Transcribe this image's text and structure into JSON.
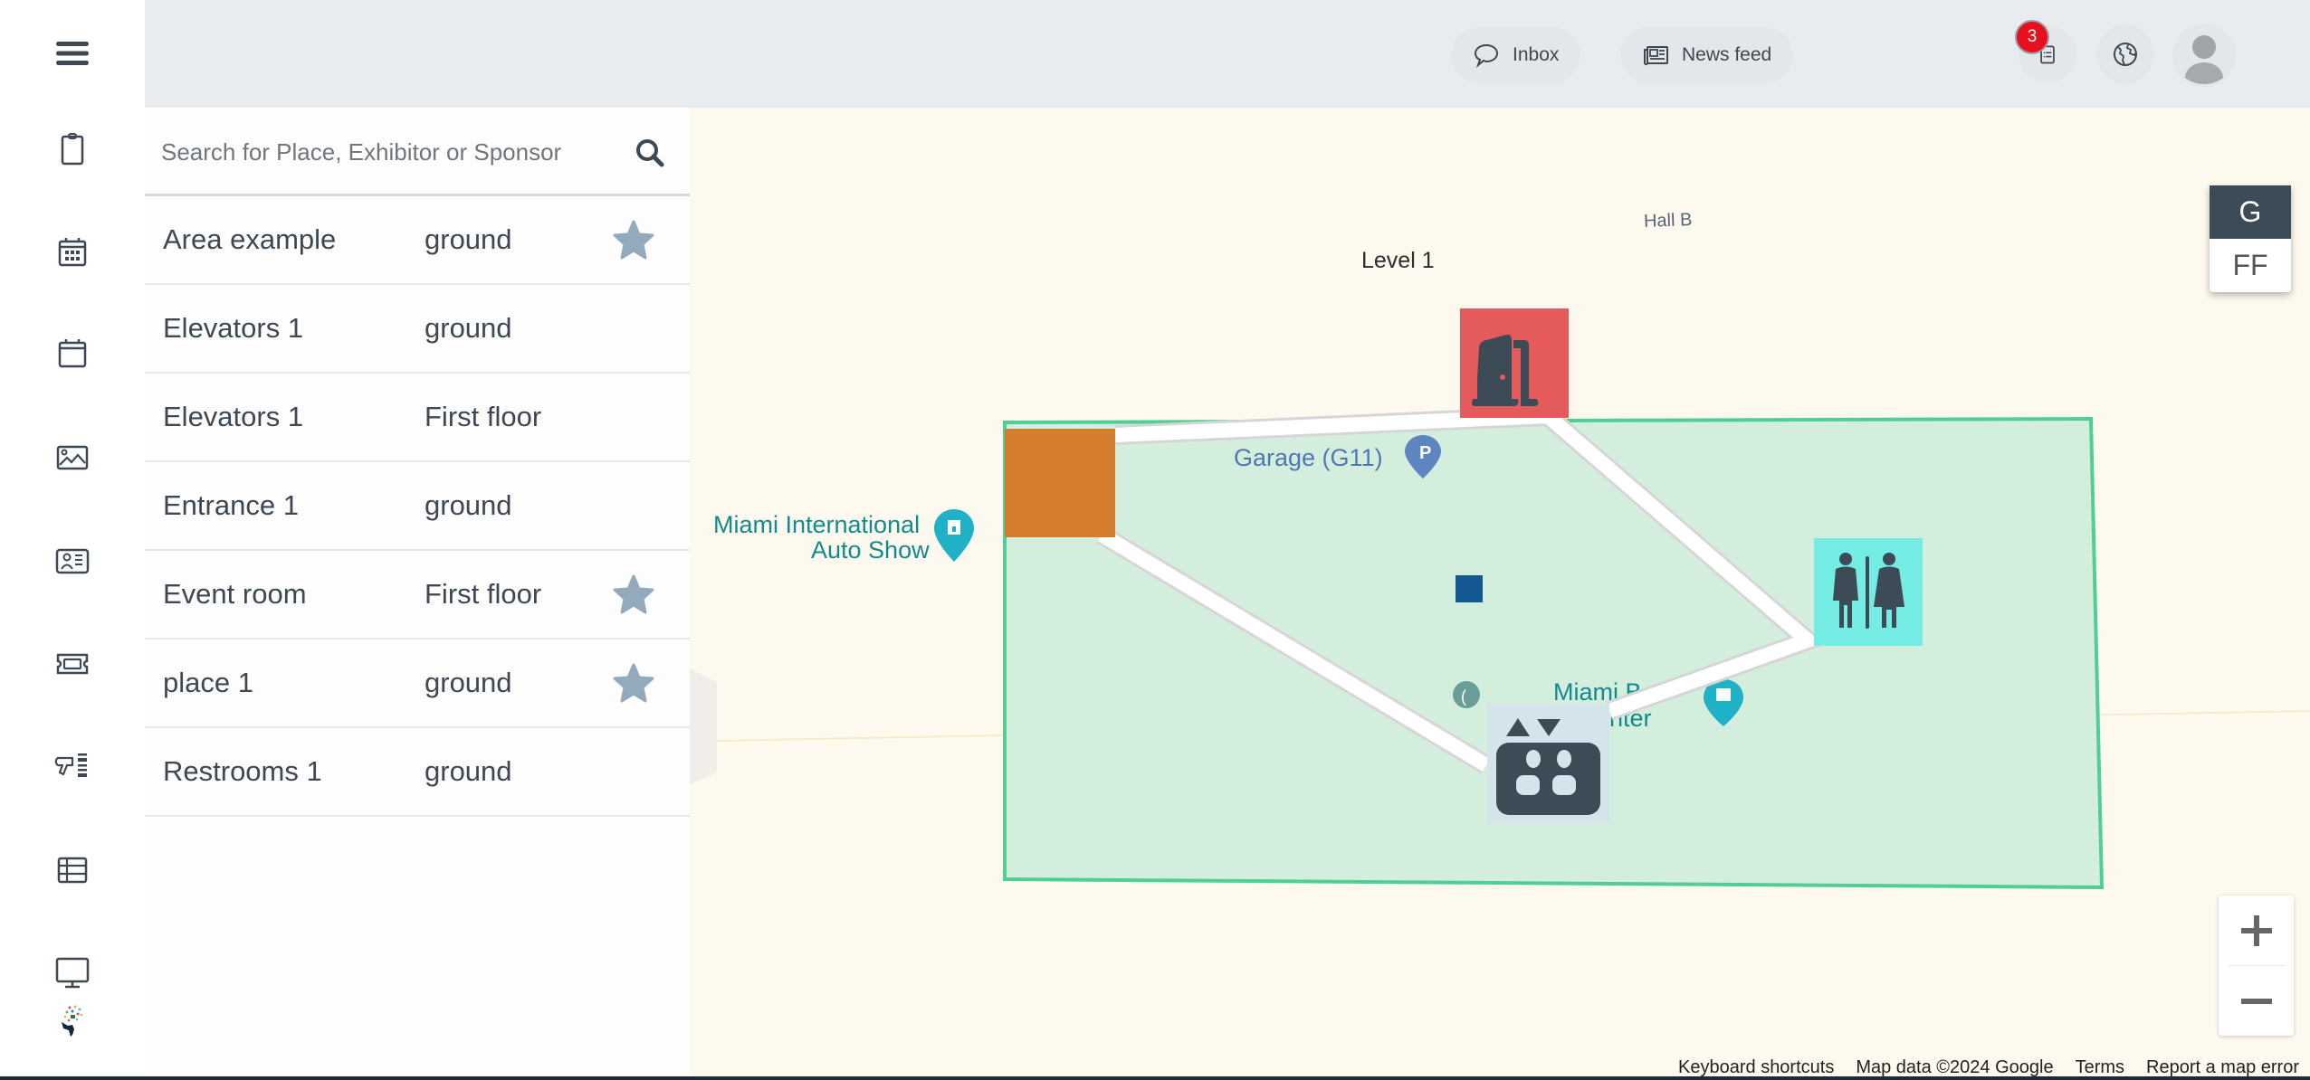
{
  "sidebar": {
    "items": [
      {
        "name": "menu",
        "icon": "hamburger-menu-icon"
      },
      {
        "name": "agenda",
        "icon": "clipboard-icon"
      },
      {
        "name": "calendar-grid",
        "icon": "calendar-grid-icon"
      },
      {
        "name": "calendar",
        "icon": "calendar-icon"
      },
      {
        "name": "gallery",
        "icon": "image-icon"
      },
      {
        "name": "contacts",
        "icon": "contact-card-icon"
      },
      {
        "name": "tickets",
        "icon": "ticket-icon"
      },
      {
        "name": "scanner",
        "icon": "barcode-scanner-icon"
      },
      {
        "name": "table",
        "icon": "table-icon"
      },
      {
        "name": "display",
        "icon": "monitor-icon"
      },
      {
        "name": "logo",
        "icon": "brand-logo-icon"
      }
    ]
  },
  "header": {
    "inbox_label": "Inbox",
    "newsfeed_label": "News feed",
    "notification_count": "3"
  },
  "search": {
    "placeholder": "Search for Place, Exhibitor or Sponsor",
    "value": ""
  },
  "places": [
    {
      "name": "Area example",
      "floor": "ground",
      "starred": true
    },
    {
      "name": "Elevators 1",
      "floor": "ground",
      "starred": false
    },
    {
      "name": "Elevators 1",
      "floor": "First floor",
      "starred": false
    },
    {
      "name": "Entrance 1",
      "floor": "ground",
      "starred": false
    },
    {
      "name": "Event room",
      "floor": "First floor",
      "starred": true
    },
    {
      "name": "place 1",
      "floor": "ground",
      "starred": true
    },
    {
      "name": "Restrooms 1",
      "floor": "ground",
      "starred": false
    }
  ],
  "map": {
    "labels": {
      "level": "Level 1",
      "hall": "Hall B",
      "auto_show_line1": "Miami International",
      "auto_show_line2": "Auto Show",
      "garage": "Garage (G11)",
      "convention_line1": "Miami Be",
      "convention_line2": "enter"
    },
    "levels": [
      {
        "label": "G",
        "active": true
      },
      {
        "label": "FF",
        "active": false
      }
    ],
    "zoom_in": "+",
    "zoom_out": "−",
    "attribution": {
      "shortcuts": "Keyboard shortcuts",
      "data": "Map data ©2024 Google",
      "terms": "Terms",
      "report": "Report a map error"
    },
    "colors": {
      "area_fill": "#d4eedd",
      "area_stroke": "#4fcf94",
      "area_marker": "#d27c2c",
      "entrance": "#e55a5a",
      "restroom": "#74ebe3",
      "elevator_bg": "#d3e4ea",
      "point": "#135891",
      "icon_dark": "#3d4b57",
      "route": "#ffffff"
    }
  }
}
